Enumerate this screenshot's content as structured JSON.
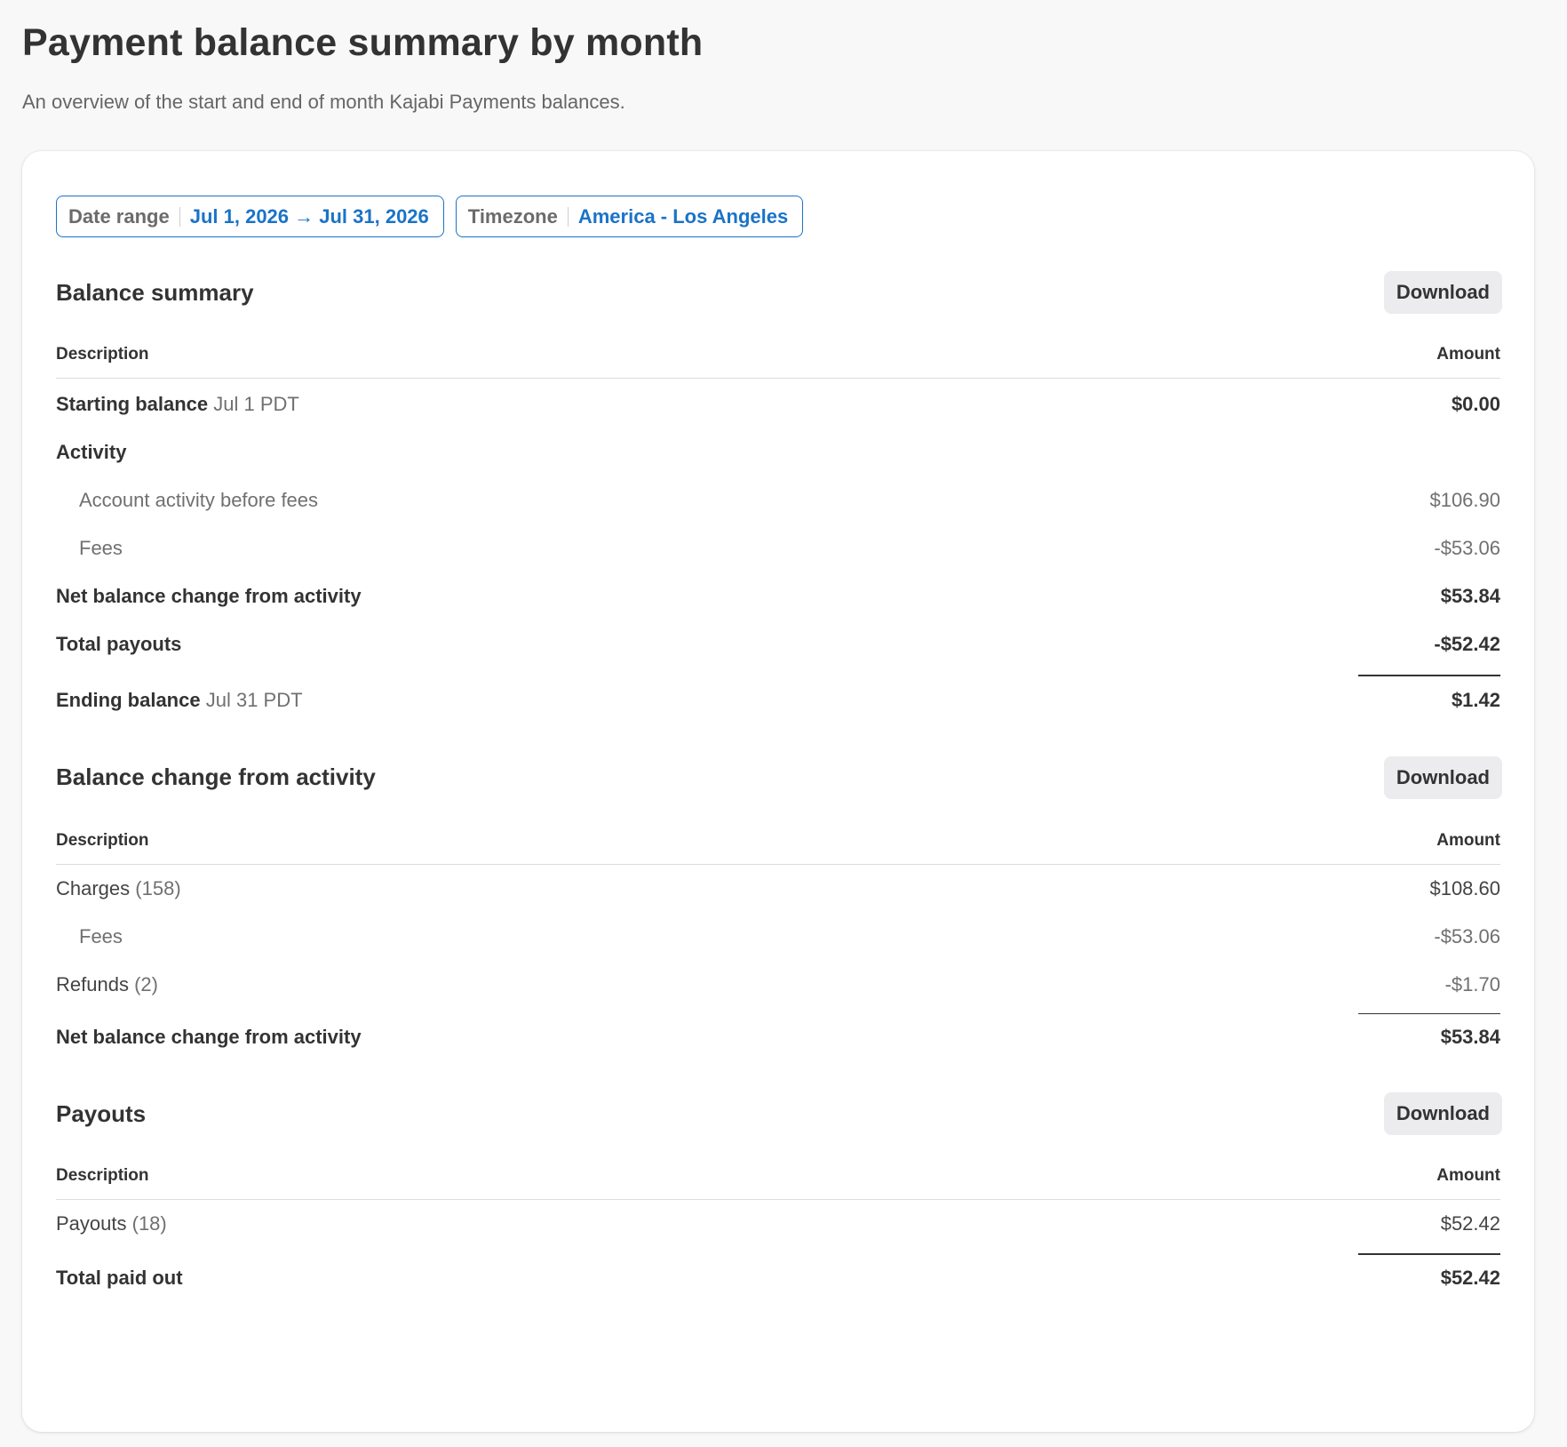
{
  "header": {
    "title": "Payment balance summary by month",
    "subtitle": "An overview of the start and end of month Kajabi Payments balances."
  },
  "filters": {
    "date_range": {
      "label": "Date range",
      "value": "Jul 1, 2026 → Jul 31, 2026"
    },
    "timezone": {
      "label": "Timezone",
      "value": "America - Los Angeles"
    }
  },
  "columns": {
    "description": "Description",
    "amount": "Amount"
  },
  "download_label": "Download",
  "balance_summary": {
    "title": "Balance summary",
    "starting": {
      "label": "Starting balance",
      "date": "Jul 1 PDT",
      "amount": "$0.00"
    },
    "activity_label": "Activity",
    "activity_before_fees": {
      "label": "Account activity before fees",
      "amount": "$106.90"
    },
    "fees": {
      "label": "Fees",
      "amount": "-$53.06"
    },
    "net_change": {
      "label": "Net balance change from activity",
      "amount": "$53.84"
    },
    "total_payouts": {
      "label": "Total payouts",
      "amount": "-$52.42"
    },
    "ending": {
      "label": "Ending balance",
      "date": "Jul 31 PDT",
      "amount": "$1.42"
    }
  },
  "balance_change": {
    "title": "Balance change from activity",
    "charges": {
      "label": "Charges",
      "count": "(158)",
      "amount": "$108.60"
    },
    "fees": {
      "label": "Fees",
      "amount": "-$53.06"
    },
    "refunds": {
      "label": "Refunds",
      "count": "(2)",
      "amount": "-$1.70"
    },
    "net_change": {
      "label": "Net balance change from activity",
      "amount": "$53.84"
    }
  },
  "payouts": {
    "title": "Payouts",
    "payouts_row": {
      "label": "Payouts",
      "count": "(18)",
      "amount": "$52.42"
    },
    "total": {
      "label": "Total paid out",
      "amount": "$52.42"
    }
  }
}
